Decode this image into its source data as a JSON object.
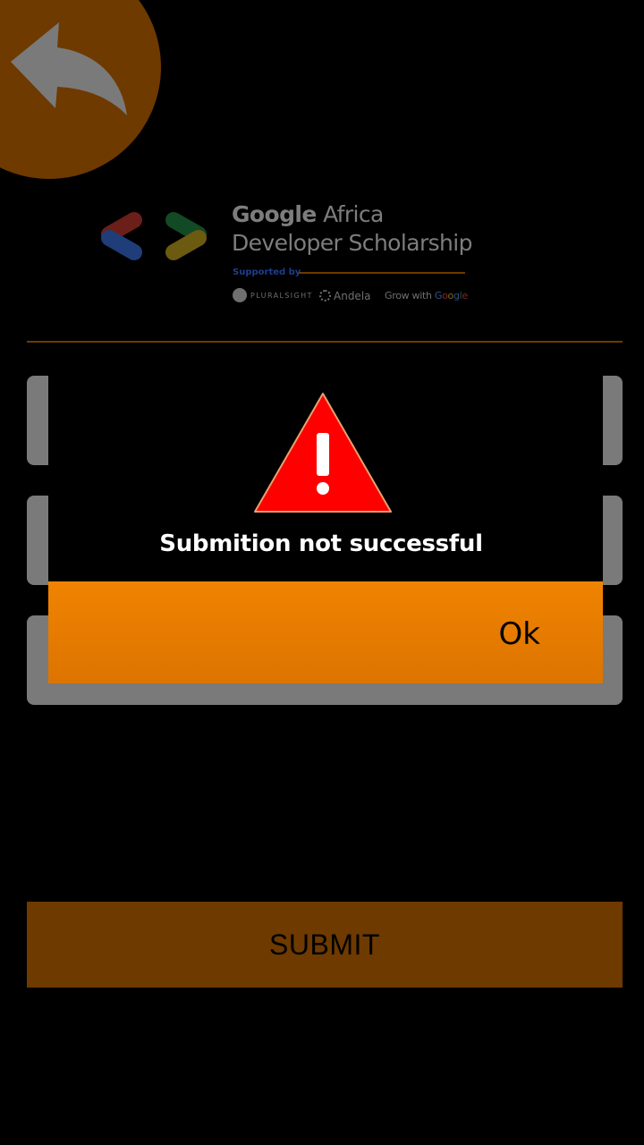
{
  "header": {
    "back_icon": "back-arrow-icon"
  },
  "logo": {
    "title_bold": "Google",
    "title_rest": "Africa",
    "title_line2": "Developer Scholarship",
    "supported_by": "Supported by",
    "sponsors": {
      "pluralsight": "PLURALSIGHT",
      "andela": "Andela",
      "grow_prefix": "Grow with ",
      "grow_letters": [
        "G",
        "o",
        "o",
        "g",
        "l",
        "e"
      ]
    }
  },
  "form": {
    "submit_label": "SUBMIT"
  },
  "dialog": {
    "icon": "warning-icon",
    "message": "Submition not successful",
    "ok_label": "Ok"
  },
  "colors": {
    "background": "#000000",
    "accent_dim": "#6e3a00",
    "ok_button": "#f08300",
    "field_overlay": "#7a7a7a",
    "warning_red": "#ff0000"
  }
}
